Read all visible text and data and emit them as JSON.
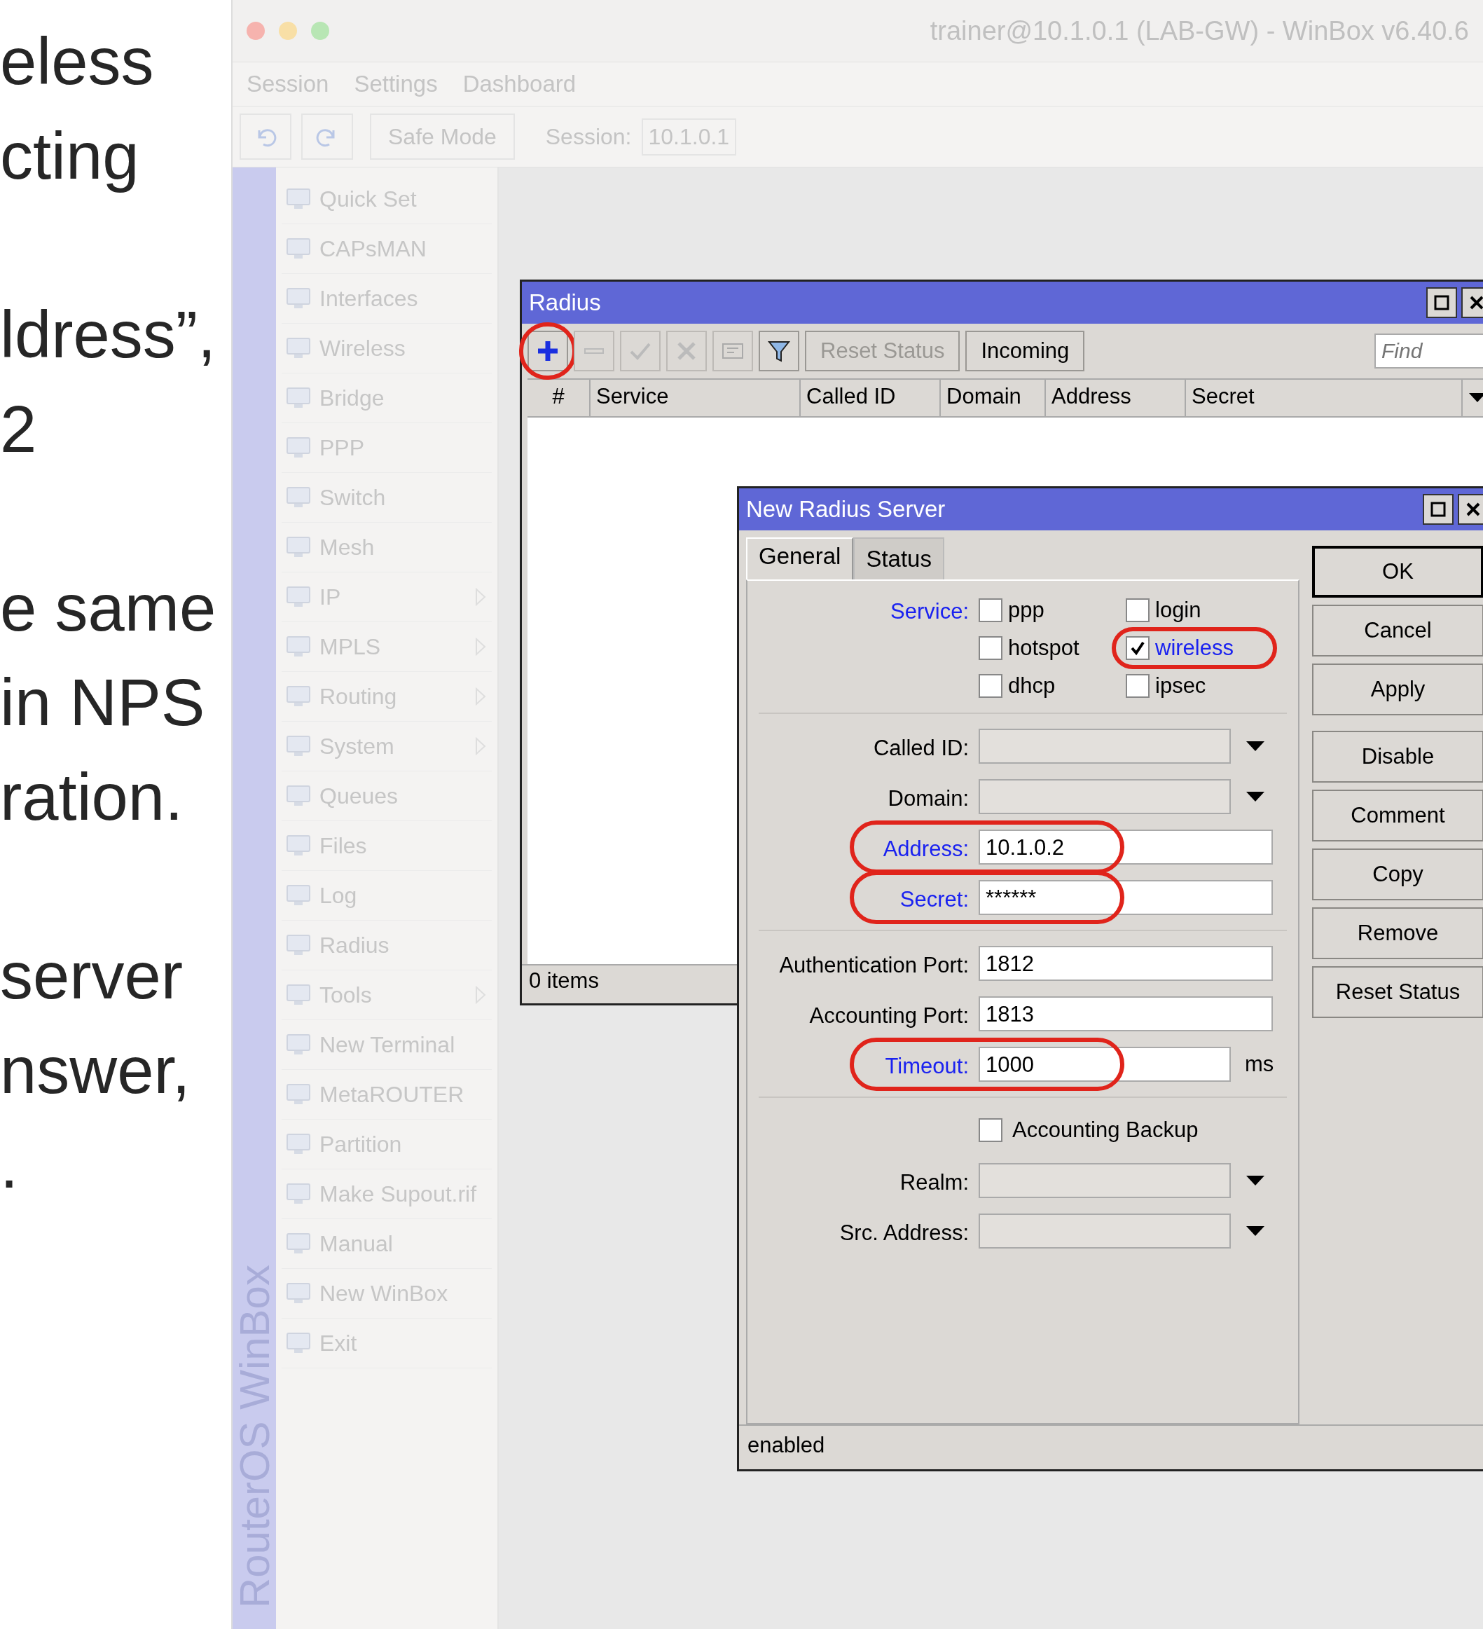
{
  "slide_text": [
    [
      "eless",
      "cting"
    ],
    [
      "ldress”,",
      "2"
    ],
    [
      "e same",
      "in NPS",
      "ration."
    ],
    [
      "server",
      "nswer,",
      "."
    ]
  ],
  "window": {
    "title": "trainer@10.1.0.1 (LAB-GW) - WinBox v6.40.6"
  },
  "menu": [
    "Session",
    "Settings",
    "Dashboard"
  ],
  "toolbar": {
    "safe_mode": "Safe Mode",
    "session_label": "Session:",
    "session_value": "10.1.0.1"
  },
  "sidebar": {
    "brand": "RouterOS WinBox",
    "items": [
      {
        "label": "Quick Set",
        "submenu": false
      },
      {
        "label": "CAPsMAN",
        "submenu": false
      },
      {
        "label": "Interfaces",
        "submenu": false
      },
      {
        "label": "Wireless",
        "submenu": false
      },
      {
        "label": "Bridge",
        "submenu": false
      },
      {
        "label": "PPP",
        "submenu": false
      },
      {
        "label": "Switch",
        "submenu": false
      },
      {
        "label": "Mesh",
        "submenu": false
      },
      {
        "label": "IP",
        "submenu": true
      },
      {
        "label": "MPLS",
        "submenu": true
      },
      {
        "label": "Routing",
        "submenu": true
      },
      {
        "label": "System",
        "submenu": true
      },
      {
        "label": "Queues",
        "submenu": false
      },
      {
        "label": "Files",
        "submenu": false
      },
      {
        "label": "Log",
        "submenu": false
      },
      {
        "label": "Radius",
        "submenu": false
      },
      {
        "label": "Tools",
        "submenu": true
      },
      {
        "label": "New Terminal",
        "submenu": false
      },
      {
        "label": "MetaROUTER",
        "submenu": false
      },
      {
        "label": "Partition",
        "submenu": false
      },
      {
        "label": "Make Supout.rif",
        "submenu": false
      },
      {
        "label": "Manual",
        "submenu": false
      },
      {
        "label": "New WinBox",
        "submenu": false
      },
      {
        "label": "Exit",
        "submenu": false
      }
    ]
  },
  "radius": {
    "title": "Radius",
    "tools": [
      {
        "kind": "add",
        "disabled": false,
        "highlighted": true
      },
      {
        "kind": "remove",
        "disabled": true,
        "highlighted": false
      },
      {
        "kind": "enable",
        "disabled": true,
        "highlighted": false
      },
      {
        "kind": "disable",
        "disabled": true,
        "highlighted": false
      },
      {
        "kind": "comment",
        "disabled": true,
        "highlighted": false
      },
      {
        "kind": "filter",
        "disabled": false,
        "highlighted": false
      }
    ],
    "buttons": [
      {
        "label": "Reset Status",
        "disabled": true
      },
      {
        "label": "Incoming",
        "disabled": false
      }
    ],
    "find": {
      "placeholder": "Find"
    },
    "columns": [
      "#",
      "Service",
      "Called ID",
      "Domain",
      "Address",
      "Secret"
    ],
    "status": "0 items"
  },
  "dialog": {
    "title": "New Radius Server",
    "tabs": [
      {
        "label": "General",
        "selected": true
      },
      {
        "label": "Status",
        "selected": false
      }
    ],
    "services": {
      "label": "Service:",
      "emphasized": true,
      "options": [
        {
          "label": "ppp",
          "checked": false,
          "emphasized": false,
          "highlighted": false
        },
        {
          "label": "login",
          "checked": false,
          "emphasized": false,
          "highlighted": false
        },
        {
          "label": "hotspot",
          "checked": false,
          "emphasized": false,
          "highlighted": false
        },
        {
          "label": "wireless",
          "checked": true,
          "emphasized": true,
          "highlighted": true
        },
        {
          "label": "dhcp",
          "checked": false,
          "emphasized": false,
          "highlighted": false
        },
        {
          "label": "ipsec",
          "checked": false,
          "emphasized": false,
          "highlighted": false
        }
      ]
    },
    "field_groups": [
      [
        {
          "kind": "dropdown",
          "label": "Called ID:",
          "emphasized": false,
          "highlighted": false
        },
        {
          "kind": "dropdown",
          "label": "Domain:",
          "emphasized": false,
          "highlighted": false
        },
        {
          "kind": "text",
          "label": "Address:",
          "value": "10.1.0.2",
          "emphasized": true,
          "highlighted": true
        },
        {
          "kind": "text",
          "label": "Secret:",
          "value": "******",
          "emphasized": true,
          "highlighted": true
        }
      ],
      [
        {
          "kind": "text",
          "label": "Authentication Port:",
          "value": "1812",
          "emphasized": false,
          "highlighted": false
        },
        {
          "kind": "text",
          "label": "Accounting Port:",
          "value": "1813",
          "emphasized": false,
          "highlighted": false
        },
        {
          "kind": "unit",
          "label": "Timeout:",
          "value": "1000",
          "unit": "ms",
          "emphasized": true,
          "highlighted": true
        }
      ],
      [
        {
          "kind": "checkbox",
          "label": "Accounting Backup",
          "checked": false,
          "emphasized": false,
          "highlighted": false
        },
        {
          "kind": "dropdown",
          "label": "Realm:",
          "emphasized": false,
          "highlighted": false
        },
        {
          "kind": "dropdown",
          "label": "Src. Address:",
          "emphasized": false,
          "highlighted": false
        }
      ]
    ],
    "buttons": [
      [
        {
          "label": "OK",
          "default": true
        },
        {
          "label": "Cancel",
          "default": false
        },
        {
          "label": "Apply",
          "default": false
        }
      ],
      [
        {
          "label": "Disable",
          "default": false
        },
        {
          "label": "Comment",
          "default": false
        },
        {
          "label": "Copy",
          "default": false
        },
        {
          "label": "Remove",
          "default": false
        },
        {
          "label": "Reset Status",
          "default": false
        }
      ]
    ],
    "status": "enabled"
  }
}
